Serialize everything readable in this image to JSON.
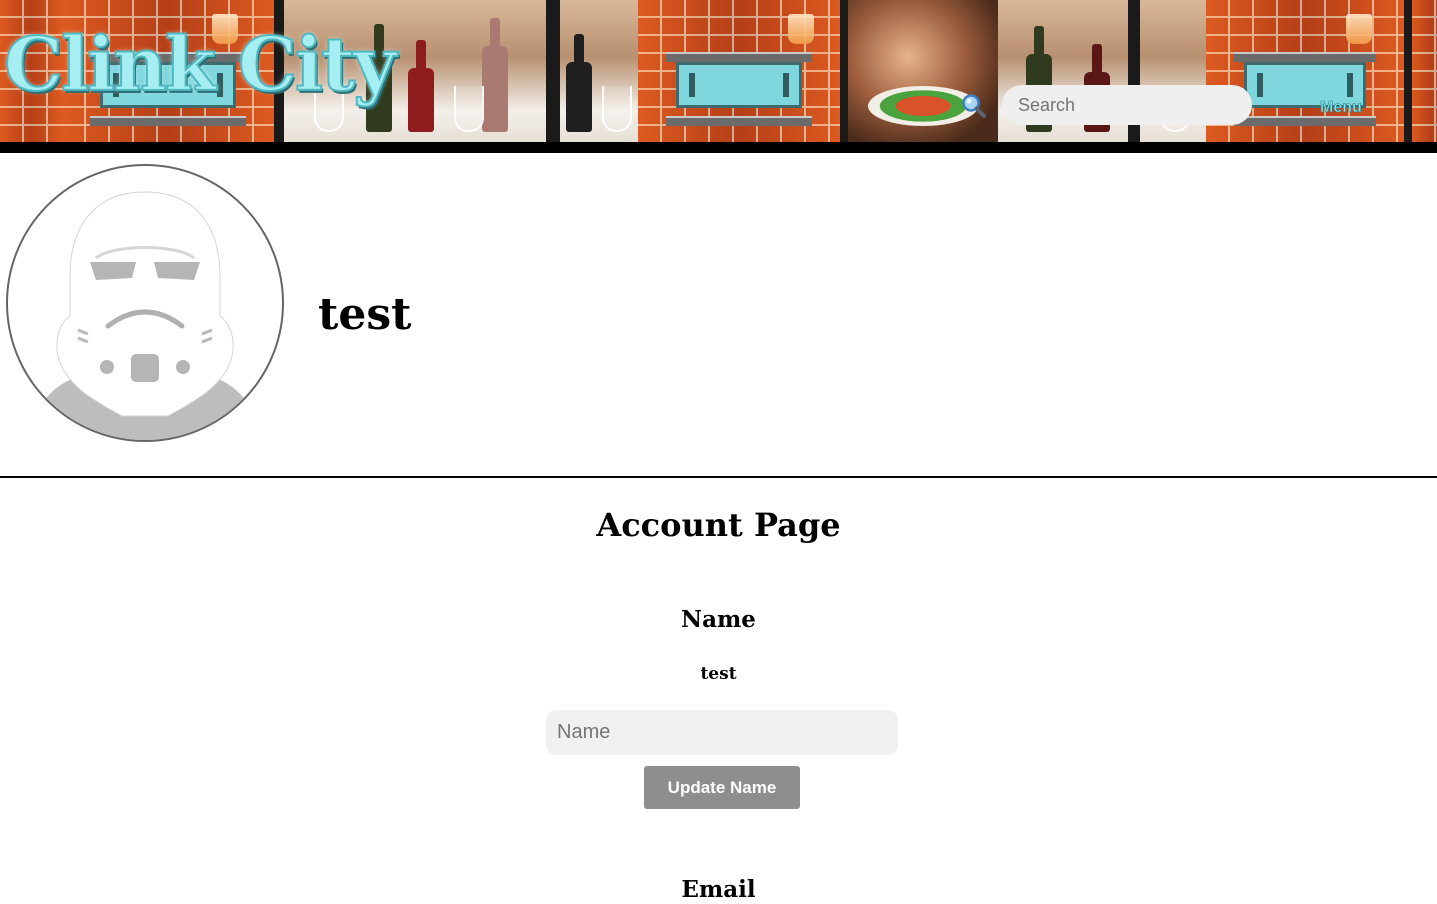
{
  "header": {
    "logo_text": "Clink City",
    "search": {
      "placeholder": "Search",
      "value": ""
    },
    "menu_label": "Menu",
    "icons": {
      "search": "search-icon"
    }
  },
  "profile": {
    "display_name": "test",
    "avatar_icon": "stormtrooper-avatar"
  },
  "account": {
    "title": "Account Page",
    "name_section": {
      "heading": "Name",
      "current_value": "test",
      "input_placeholder": "Name",
      "button_label": "Update Name"
    },
    "email_section": {
      "heading": "Email"
    }
  },
  "colors": {
    "logo": "#a6eef2",
    "menu": "#7fe4ea",
    "button_bg": "#8e8e8e",
    "input_bg": "#f0f0f0",
    "banner_bg": "#000000"
  }
}
